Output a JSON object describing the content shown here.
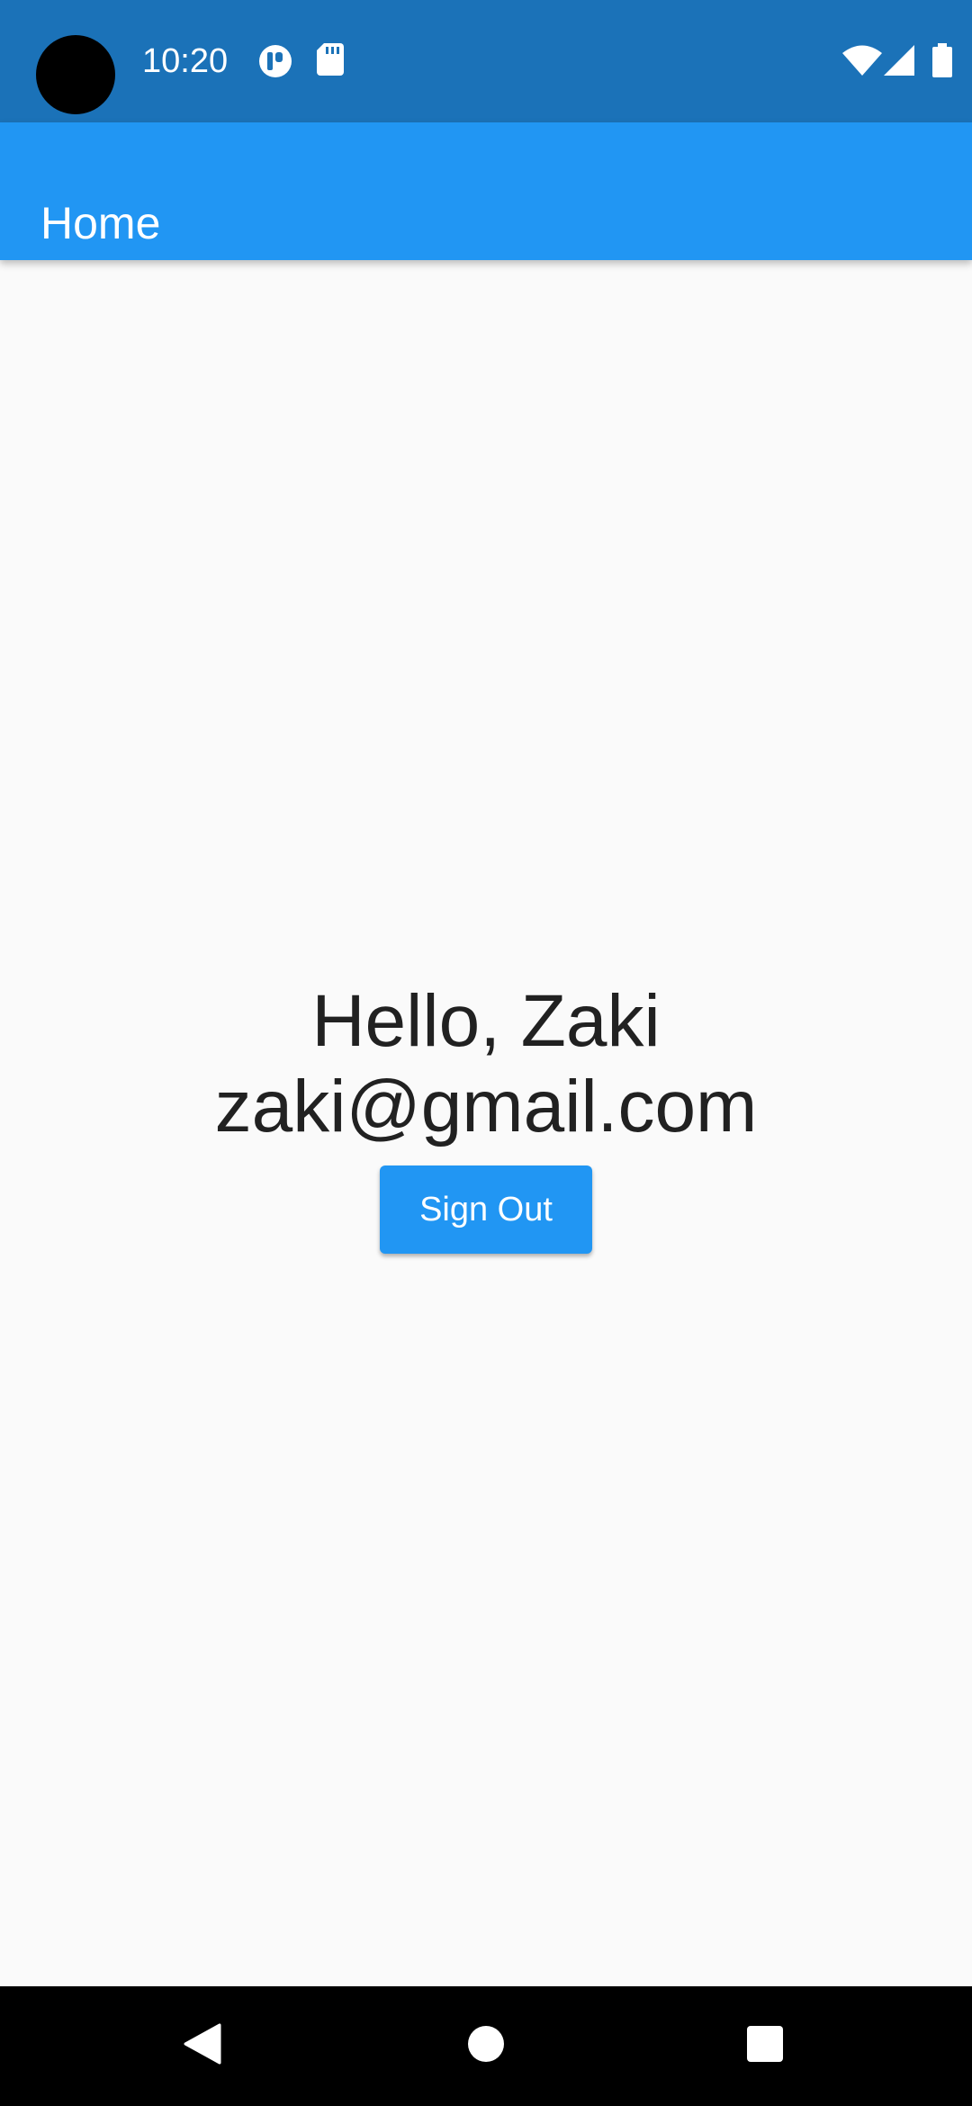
{
  "status_bar": {
    "time": "10:20",
    "icons": [
      "camera-cutout",
      "data-saver-icon",
      "sd-card-icon",
      "wifi-icon",
      "cell-signal-icon",
      "battery-icon"
    ],
    "background": "#1b72b8"
  },
  "app_bar": {
    "title": "Home",
    "background": "#2196f3"
  },
  "main": {
    "greeting": "Hello, Zaki",
    "email": "zaki@gmail.com",
    "sign_out_label": "Sign Out"
  },
  "nav_bar": {
    "icons": [
      "back-icon",
      "home-icon",
      "recents-icon"
    ]
  }
}
